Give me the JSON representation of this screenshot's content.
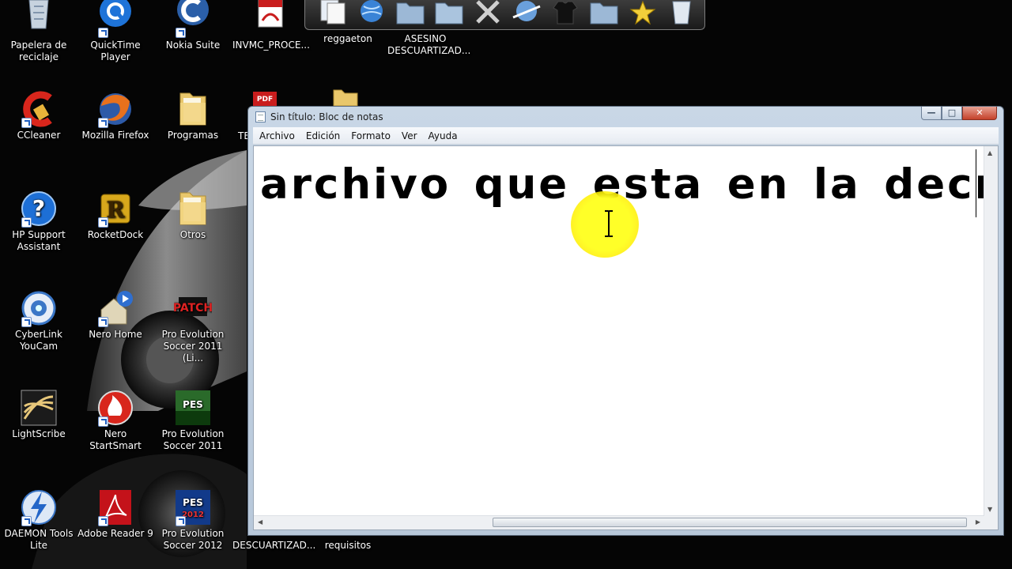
{
  "desktop_icons": [
    {
      "label": "Papelera de reciclaje",
      "icon": "recycle-bin-icon"
    },
    {
      "label": "QuickTime Player",
      "icon": "quicktime-icon"
    },
    {
      "label": "Nokia Suite",
      "icon": "nokia-suite-icon"
    },
    {
      "label": "INVMC_PROCE...",
      "icon": "pdf-icon"
    },
    {
      "label": "reggaeton",
      "icon": "folder-icon"
    },
    {
      "label": "ASESINO DESCUARTIZAD...",
      "icon": "file-icon"
    },
    {
      "label": "CCleaner",
      "icon": "ccleaner-icon"
    },
    {
      "label": "Mozilla Firefox",
      "icon": "firefox-icon"
    },
    {
      "label": "Programas",
      "icon": "folder-icon"
    },
    {
      "label": "TE",
      "icon": "pdf-icon"
    },
    {
      "label": "HP Support Assistant",
      "icon": "help-icon"
    },
    {
      "label": "RocketDock",
      "icon": "rocketdock-icon"
    },
    {
      "label": "Otros",
      "icon": "folder-icon"
    },
    {
      "label": "CyberLink YouCam",
      "icon": "webcam-icon"
    },
    {
      "label": "Nero Home",
      "icon": "nero-home-icon"
    },
    {
      "label": "Pro Evolution Soccer 2011 (Li...",
      "icon": "pes-patch-icon"
    },
    {
      "label": "LightScribe",
      "icon": "lightscribe-icon"
    },
    {
      "label": "Nero StartSmart",
      "icon": "nero-startsmart-icon"
    },
    {
      "label": "Pro Evolution Soccer 2011",
      "icon": "pes2011-icon"
    },
    {
      "label": "DAEMON Tools Lite",
      "icon": "daemon-tools-icon"
    },
    {
      "label": "Adobe Reader 9",
      "icon": "adobe-reader-icon"
    },
    {
      "label": "Pro Evolution Soccer 2012",
      "icon": "pes2012-icon"
    },
    {
      "label": "DESCUARTIZAD...",
      "icon": "file-icon"
    },
    {
      "label": "requisitos",
      "icon": "file-icon"
    }
  ],
  "dock": {
    "items": [
      "documents-icon",
      "globe-icon",
      "folder-icon",
      "folder-icon",
      "tools-icon",
      "network-icon",
      "shirt-icon",
      "folder-icon",
      "star-icon",
      "trash-icon"
    ]
  },
  "notepad": {
    "title": "Sin título: Bloc de notas",
    "menu": [
      "Archivo",
      "Edición",
      "Formato",
      "Ver",
      "Ayuda"
    ],
    "content": "archivo que esta en la decrip",
    "buttons": {
      "minimize": "—",
      "maximize": "□",
      "close": "✕"
    }
  },
  "colors": {
    "cursor_highlight": "#ffff28",
    "titlebar": "#c9d7e6",
    "close_button": "#c4412a"
  }
}
